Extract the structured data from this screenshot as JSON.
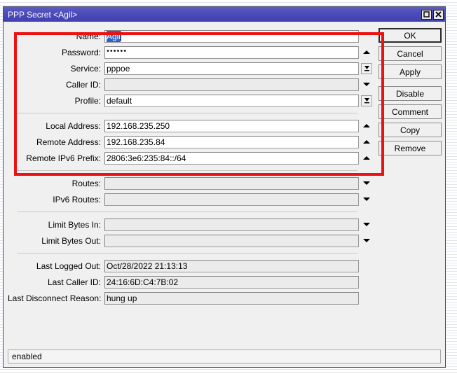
{
  "window": {
    "title": "PPP Secret <Agil>",
    "titlebar_buttons": [
      {
        "name": "maximize",
        "icon": "maximize-icon"
      },
      {
        "name": "close",
        "icon": "close-icon"
      }
    ]
  },
  "form": {
    "groups": [
      {
        "id": "credentials",
        "fields": [
          {
            "label": "Name:",
            "value": "Agil",
            "state": "selected",
            "widget": "none"
          },
          {
            "label": "Password:",
            "value": "••••••",
            "state": "masked",
            "widget": "arrow-up"
          },
          {
            "label": "Service:",
            "value": "pppoe",
            "state": "normal",
            "widget": "combo"
          },
          {
            "label": "Caller ID:",
            "value": "",
            "state": "disabled",
            "widget": "arrow-down"
          },
          {
            "label": "Profile:",
            "value": "default",
            "state": "normal",
            "widget": "combo"
          }
        ]
      },
      {
        "id": "addresses",
        "fields": [
          {
            "label": "Local Address:",
            "value": "192.168.235.250",
            "state": "normal",
            "widget": "arrow-up"
          },
          {
            "label": "Remote Address:",
            "value": "192.168.235.84",
            "state": "normal",
            "widget": "arrow-up"
          },
          {
            "label": "Remote IPv6 Prefix:",
            "value": "2806:3e6:235:84::/64",
            "state": "normal",
            "widget": "arrow-up"
          }
        ]
      },
      {
        "id": "routes",
        "fields": [
          {
            "label": "Routes:",
            "value": "",
            "state": "disabled",
            "widget": "arrow-down"
          },
          {
            "label": "IPv6 Routes:",
            "value": "",
            "state": "disabled",
            "widget": "arrow-down"
          }
        ]
      },
      {
        "id": "limits",
        "fields": [
          {
            "label": "Limit Bytes In:",
            "value": "",
            "state": "disabled",
            "widget": "arrow-down"
          },
          {
            "label": "Limit Bytes Out:",
            "value": "",
            "state": "disabled",
            "widget": "arrow-down"
          }
        ]
      },
      {
        "id": "last-session",
        "fields": [
          {
            "label": "Last Logged Out:",
            "value": "Oct/28/2022 21:13:13",
            "state": "readonly",
            "widget": "none"
          },
          {
            "label": "Last Caller ID:",
            "value": "24:16:6D:C4:7B:02",
            "state": "readonly",
            "widget": "none"
          },
          {
            "label": "Last Disconnect Reason:",
            "value": "hung up",
            "state": "readonly",
            "widget": "none"
          }
        ]
      }
    ]
  },
  "buttons": [
    {
      "label": "OK",
      "default": true
    },
    {
      "label": "Cancel",
      "default": false
    },
    {
      "label": "Apply",
      "default": false
    },
    {
      "label": "Disable",
      "default": false
    },
    {
      "label": "Comment",
      "default": false
    },
    {
      "label": "Copy",
      "default": false
    },
    {
      "label": "Remove",
      "default": false
    }
  ],
  "statusbar": {
    "text": "enabled"
  },
  "annotation": {
    "color": "#ee1111",
    "shape": "rectangle"
  },
  "colors": {
    "titlebar": "#4a4ab8",
    "selection": "#3163c4",
    "annotation": "#ee1111",
    "window_bg": "#f0f0f0"
  }
}
